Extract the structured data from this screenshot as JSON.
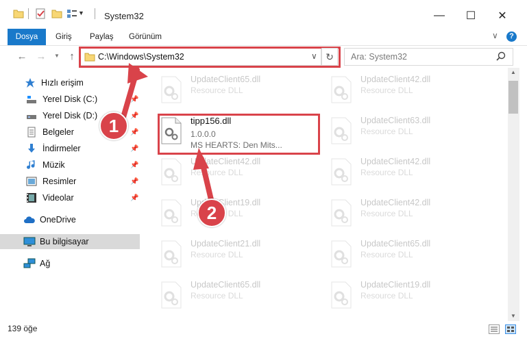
{
  "window": {
    "title": "System32",
    "minimize_glyph": "—",
    "maximize_glyph": "☐",
    "close_glyph": "✕"
  },
  "ribbon": {
    "tabs": [
      {
        "label": "Dosya"
      },
      {
        "label": "Giriş"
      },
      {
        "label": "Paylaş"
      },
      {
        "label": "Görünüm"
      }
    ],
    "expand_glyph": "∨",
    "help_glyph": "?"
  },
  "address": {
    "path": "C:\\Windows\\System32",
    "dropdown_glyph": "∨",
    "refresh_glyph": "↻"
  },
  "search": {
    "placeholder": "Ara: System32"
  },
  "sidebar": {
    "quick_access": "Hızlı erişim",
    "items": [
      {
        "label": "Yerel Disk (C:)",
        "icon": "drive-icon",
        "pinned": true
      },
      {
        "label": "Yerel Disk (D:)",
        "icon": "drive-icon",
        "pinned": true
      },
      {
        "label": "Belgeler",
        "icon": "documents-icon",
        "pinned": true
      },
      {
        "label": "İndirmeler",
        "icon": "download-icon",
        "pinned": true
      },
      {
        "label": "Müzik",
        "icon": "music-icon",
        "pinned": true
      },
      {
        "label": "Resimler",
        "icon": "pictures-icon",
        "pinned": true
      },
      {
        "label": "Videolar",
        "icon": "video-icon",
        "pinned": true
      }
    ],
    "onedrive": "OneDrive",
    "this_pc": "Bu bilgisayar",
    "network": "Ağ"
  },
  "files": {
    "left_column": [
      {
        "name": "UpdateClient65.dll",
        "type": "Resource DLL"
      },
      {
        "name": "tipp156.dll",
        "version": "1.0.0.0",
        "desc": "MS HEARTS: Den Mits..."
      },
      {
        "name": "UpdateClient42.dll",
        "type": "Resource DLL"
      },
      {
        "name": "UpdateClient19.dll",
        "type": "Resource DLL"
      },
      {
        "name": "UpdateClient21.dll",
        "type": "Resource DLL"
      },
      {
        "name": "UpdateClient65.dll",
        "type": "Resource DLL"
      }
    ],
    "right_column": [
      {
        "name": "UpdateClient42.dll",
        "type": "Resource DLL"
      },
      {
        "name": "UpdateClient63.dll",
        "type": "Resource DLL"
      },
      {
        "name": "UpdateClient42.dll",
        "type": "Resource DLL"
      },
      {
        "name": "UpdateClient42.dll",
        "type": "Resource DLL"
      },
      {
        "name": "UpdateClient65.dll",
        "type": "Resource DLL"
      },
      {
        "name": "UpdateClient19.dll",
        "type": "Resource DLL"
      }
    ]
  },
  "status": {
    "item_count": "139 öğe"
  },
  "callouts": {
    "one": "1",
    "two": "2"
  },
  "colors": {
    "accent": "#1979ca",
    "highlight": "#d9434a",
    "folder": "#f8d775"
  }
}
